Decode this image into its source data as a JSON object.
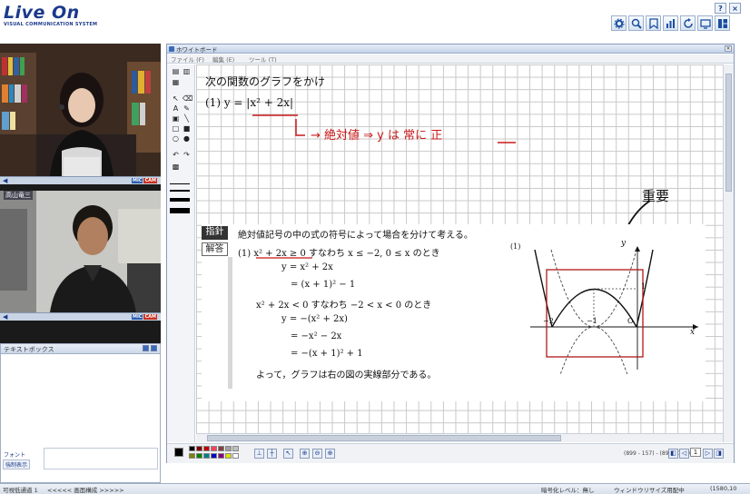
{
  "colors": {
    "brand": "#1b3a8a",
    "red_ink": "#c81818",
    "grid": "#c8c8c8"
  },
  "header": {
    "logo": "Live On",
    "logo_sub": "VISUAL COMMUNICATION SYSTEM",
    "help_label": "?",
    "close_label": "×",
    "toolbar_icons": [
      "gear-icon",
      "search-icon",
      "bookmark-icon",
      "chart-icon",
      "refresh-icon",
      "monitor-icon",
      "layout-icon"
    ]
  },
  "video": {
    "badge_mic": "MIC",
    "badge_cam": "CAM",
    "speaker_glyph": "◀",
    "participant2_name": "高山竜三"
  },
  "textbox": {
    "title": "テキストボックス",
    "font_label": "フォント",
    "send_label": "強制表示"
  },
  "statusbar": {
    "left": "可視低通道 1",
    "nav": "<<<<< 画面構成 >>>>>",
    "encrypt": "暗号化レベル：無し",
    "window": "ウィンドウリサイズ用配中",
    "coords": "(1580,10"
  },
  "whiteboard": {
    "title": "ホワイトボード",
    "close_label": "×",
    "menu": [
      "ファイル (F)",
      "編集 (E)",
      "ツール (T)"
    ],
    "coord_readout": "(899 - 157) - (899 - 157)",
    "page_number": "1"
  },
  "content": {
    "question_title": "次の関数のグラフをかけ",
    "question_item": "(1)  y = |x² + 2x|",
    "red_note": "→ 絶対値 ⇒ y は 常に 正",
    "handwritten_note": "重要",
    "tag_hint": "指針",
    "tag_answer": "解答",
    "hint_text": "絶対値記号の中の式の符号によって場合を分けて考える。",
    "lines": [
      "(1)  x² + 2x ≥ 0   すなわち   x ≤ −2,  0 ≤ x  のとき",
      "y = x² + 2x",
      "= (x + 1)² − 1",
      "x² + 2x < 0   すなわち   −2 < x < 0  のとき",
      "y = −(x² + 2x)",
      "= −x² − 2x",
      "= −(x + 1)² + 1",
      "よって，グラフは右の図の実線部分である。"
    ],
    "graph": {
      "label_num": "(1)",
      "axis_y": "y",
      "axis_x": "x",
      "tick_1": "1",
      "tick_m1": "−1",
      "tick_m2": "−2",
      "origin": "O"
    }
  }
}
